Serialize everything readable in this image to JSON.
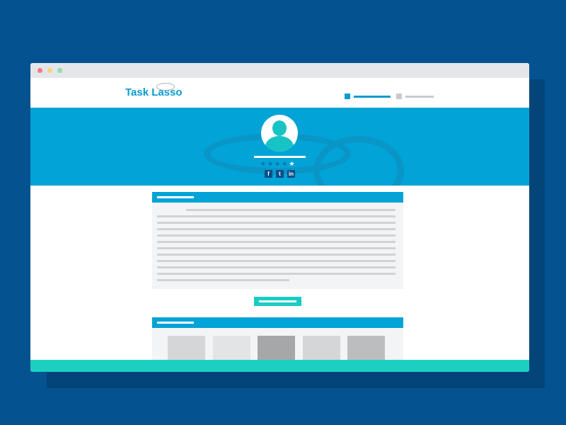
{
  "colors": {
    "background": "#04528f",
    "accent_blue": "#02a3d6",
    "accent_teal": "#18cdc2",
    "placeholder_gray": "#cfd3d6"
  },
  "window": {
    "controls": [
      "close",
      "minimize",
      "maximize"
    ]
  },
  "header": {
    "logo_text": "Task Lasso",
    "nav_steps": [
      {
        "state": "active"
      },
      {
        "state": "inactive"
      }
    ]
  },
  "profile": {
    "avatar_icon": "user-silhouette-icon",
    "rating": {
      "filled": 1,
      "total": 5
    },
    "social_icons": [
      {
        "name": "facebook-icon",
        "glyph": "f"
      },
      {
        "name": "twitter-icon",
        "glyph": "t"
      },
      {
        "name": "linkedin-icon",
        "glyph": "in"
      }
    ]
  },
  "content": {
    "text_lines_count": 12
  },
  "gallery": {
    "thumbnails": [
      {
        "tone": "light"
      },
      {
        "tone": "lighter"
      },
      {
        "tone": "dark"
      },
      {
        "tone": "light"
      },
      {
        "tone": "medium"
      }
    ]
  }
}
